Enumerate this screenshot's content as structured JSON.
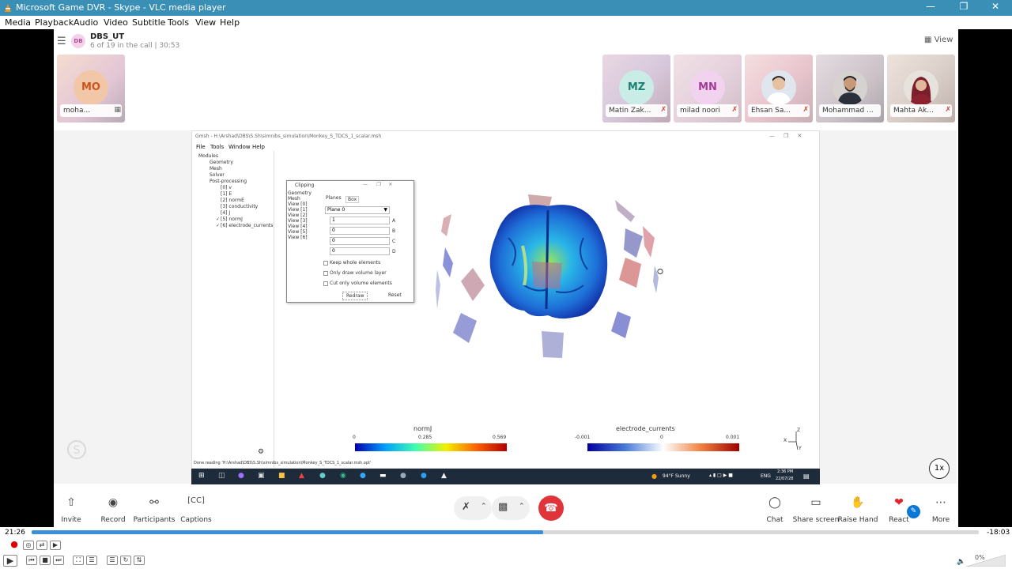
{
  "window": {
    "title": "Microsoft Game DVR - Skype - VLC media player",
    "menu": [
      "Media",
      "Playback",
      "Audio",
      "Video",
      "Subtitle",
      "Tools",
      "View",
      "Help"
    ]
  },
  "call": {
    "avatar": "DB",
    "title": "DBS_UT",
    "subtitle": "6 of 19 in the call | 30:53",
    "view_label": "View"
  },
  "participants": [
    {
      "initials": "MO",
      "name": "moha...",
      "bg": "#f2c7a8",
      "fg": "#c8551e"
    },
    {
      "initials": "MZ",
      "name": "Matin Zak...",
      "bg": "#c9ede6",
      "fg": "#1c7f72"
    },
    {
      "initials": "MN",
      "name": "milad noori",
      "bg": "#f1d3ef",
      "fg": "#a23b97"
    },
    {
      "initials": "",
      "name": "Ehsan Sa...",
      "bg": "#d9dde2",
      "fg": "#333"
    },
    {
      "initials": "",
      "name": "Mohammad ...",
      "bg": "#c9ccd1",
      "fg": "#333"
    },
    {
      "initials": "",
      "name": "Mahta Ak...",
      "bg": "#d8d1cc",
      "fg": "#333"
    }
  ],
  "gmsh": {
    "title": "Gmsh - H:\\Arshad\\DBS\\S.Sh\\simnibs_simulation\\Monkey_S_TDCS_1_scalar.msh",
    "menu": [
      "File",
      "Tools",
      "Window",
      "Help"
    ],
    "tree": [
      "Modules",
      "Geometry",
      "Mesh",
      "Solver",
      "Post-processing",
      "[0] v",
      "[1] E",
      "[2] normE",
      "[3] conductivity",
      "[4] J",
      "[5] normJ",
      "[6] electrode_currents"
    ],
    "status": "Done reading 'H:\\Arshad\\DBS\\S.Sh\\simnibs_simulation\\Monkey_S_TDCS_1_scalar.msh.opt'",
    "clipping": {
      "title": "Clipping",
      "list": [
        "Geometry",
        "Mesh",
        "View [0]",
        "View [1]",
        "View [2]",
        "View [3]",
        "View [4]",
        "View [5]",
        "View [6]"
      ],
      "tabs": [
        "Planes",
        "Box"
      ],
      "plane": "Plane 0",
      "values": [
        {
          "v": "1",
          "k": "A"
        },
        {
          "v": "0",
          "k": "B"
        },
        {
          "v": "0",
          "k": "C"
        },
        {
          "v": "0",
          "k": "D"
        }
      ],
      "checks": [
        "Keep whole elements",
        "Only draw volume layer",
        "Cut only volume elements"
      ],
      "redraw": "Redraw",
      "reset": "Reset"
    },
    "colorbar1": {
      "title": "normJ",
      "min": "0",
      "mid": "0.285",
      "max": "0.569"
    },
    "colorbar2": {
      "title": "electrode_currents",
      "min": "-0.001",
      "mid": "0",
      "max": "0.001"
    },
    "axes": {
      "x": "X",
      "y": "Y",
      "z": "Z"
    }
  },
  "taskbar": {
    "weather": "94°F  Sunny",
    "lang": "ENG",
    "time": "2:36 PM",
    "date": "22/07/28"
  },
  "zoom_label": "1x",
  "toolbar": {
    "invite": "Invite",
    "record": "Record",
    "participants": "Participants",
    "captions": "Captions",
    "chat": "Chat",
    "share": "Share screen",
    "raise": "Raise Hand",
    "react": "React",
    "more": "More"
  },
  "player": {
    "elapsed": "21:26",
    "remaining": "-18:03",
    "progress": 0.54,
    "volume": "0%"
  }
}
